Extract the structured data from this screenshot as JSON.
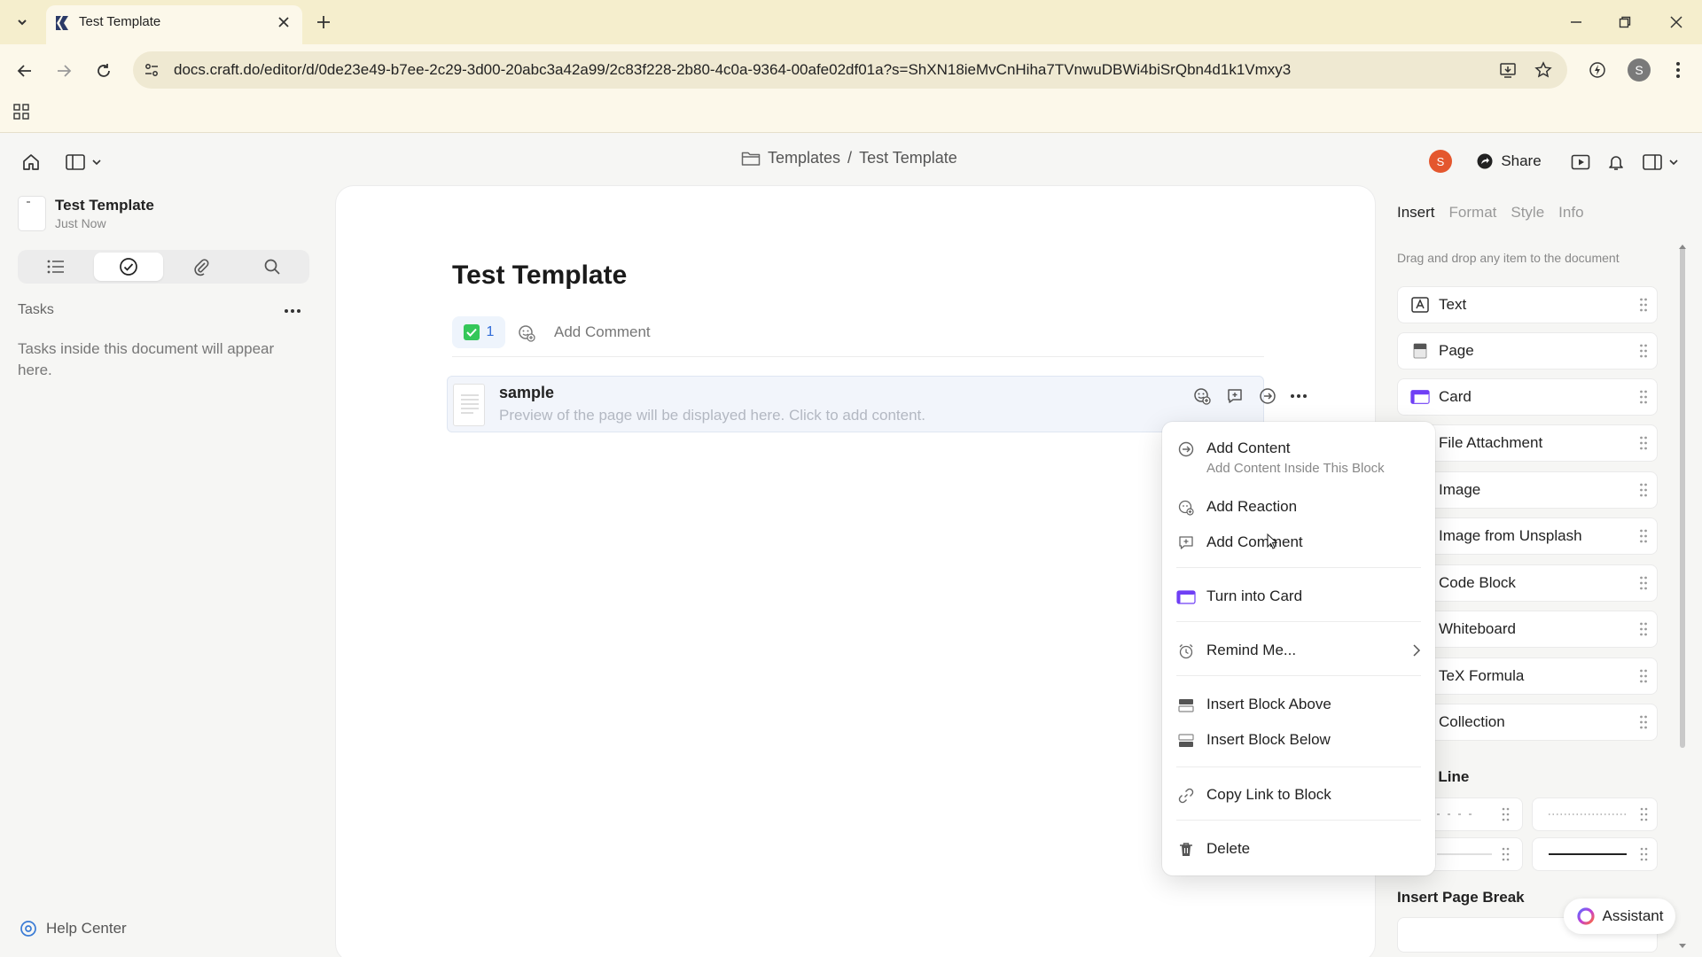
{
  "browser": {
    "tab_title": "Test Template",
    "url": "docs.craft.do/editor/d/0de23e49-b7ee-2c29-3d00-20abc3a42a99/2c83f228-2b80-4c0a-9364-00afe02df01a?s=ShXN18ieMvCnHiha7TVnwuDBWi4biSrQbn4d1k1Vmxy3",
    "profile_initial": "S"
  },
  "header": {
    "breadcrumb_folder": "Templates",
    "breadcrumb_sep": "/",
    "breadcrumb_doc": "Test Template",
    "avatar_initial": "S",
    "share_label": "Share"
  },
  "sidebar": {
    "doc_title": "Test Template",
    "doc_time": "Just Now",
    "section_title": "Tasks",
    "empty_text": "Tasks inside this document will appear here.",
    "help_label": "Help Center"
  },
  "document": {
    "title": "Test Template",
    "task_count": "1",
    "add_comment": "Add Comment",
    "block_title": "sample",
    "block_preview": "Preview of the page will be displayed here. Click to add content."
  },
  "context_menu": {
    "add_content": "Add Content",
    "add_content_sub": "Add Content Inside This Block",
    "add_reaction": "Add Reaction",
    "add_comment": "Add Comment",
    "turn_into_card": "Turn into Card",
    "remind_me": "Remind Me...",
    "insert_above": "Insert Block Above",
    "insert_below": "Insert Block Below",
    "copy_link": "Copy Link to Block",
    "delete": "Delete"
  },
  "insert_panel": {
    "tabs": [
      "Insert",
      "Format",
      "Style",
      "Info"
    ],
    "hint": "Drag and drop any item to the document",
    "items": [
      "Text",
      "Page",
      "Card",
      "File Attachment",
      "Image",
      "Image from Unsplash",
      "Code Block",
      "Whiteboard",
      "TeX Formula",
      "Collection"
    ],
    "line_section_partial": "t Line",
    "page_break_title": "Insert Page Break",
    "assistant_label": "Assistant"
  },
  "colors": {
    "accent_blue": "#2f6bd8",
    "card_purple": "#6f3ff5",
    "check_green": "#34c759",
    "avatar_orange": "#e4572e"
  }
}
